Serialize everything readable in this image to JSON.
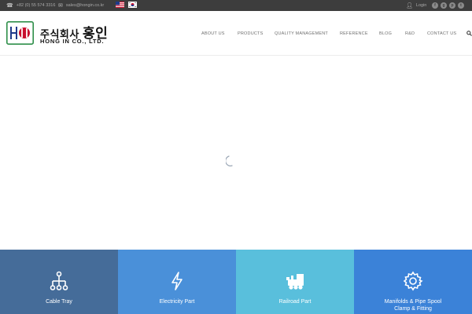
{
  "topbar": {
    "phone": "+82 (0) 55 574 3316",
    "email": "sales@hongin.co.kr",
    "login_label": "Login",
    "icons": [
      "phone-icon",
      "mail-icon",
      "us-flag-icon",
      "kr-flag-icon",
      "user-icon",
      "facebook-icon",
      "google-plus-icon",
      "pinterest-icon",
      "twitter-icon"
    ]
  },
  "header": {
    "logo_ko_small": "주식회사",
    "logo_ko_big": "홍인",
    "logo_en": "HONG IN CO., LTD.",
    "nav": [
      {
        "label": "ABOUT US"
      },
      {
        "label": "PRODUCTS"
      },
      {
        "label": "QUALITY MANAGEMENT"
      },
      {
        "label": "REFERENCE"
      },
      {
        "label": "BLOG"
      },
      {
        "label": "R&D"
      },
      {
        "label": "CONTACT US"
      }
    ]
  },
  "categories": [
    {
      "label": "Cable Tray",
      "color": "#456c99",
      "icon": "hierarchy-icon"
    },
    {
      "label": "Electricity Part",
      "color": "#4a90d9",
      "icon": "lightning-icon"
    },
    {
      "label": "Railroad Part",
      "color": "#59bfdc",
      "icon": "train-icon"
    },
    {
      "label_line1": "Manifolds & Pipe Spool",
      "label_line2": "Clamp & Fitting",
      "color": "#3b82d8",
      "icon": "gear-icon"
    }
  ],
  "colors": {
    "topbar_bg": "#3d3d3d",
    "nav_text": "#6f6f6f",
    "logo_green": "#2f8f4a",
    "logo_red": "#c8102e"
  }
}
